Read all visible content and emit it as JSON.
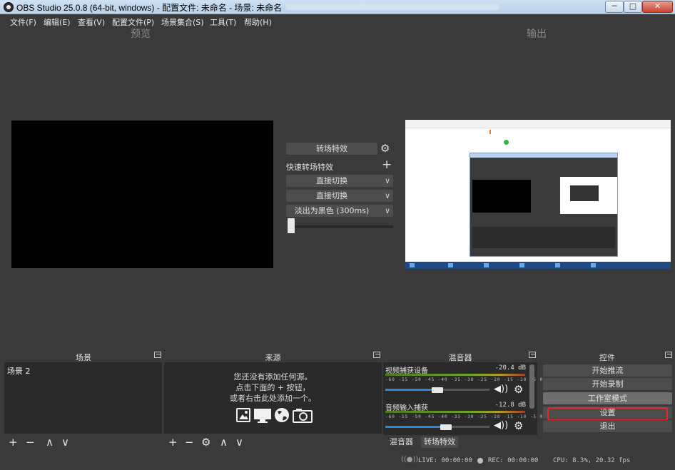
{
  "window": {
    "title": "OBS Studio 25.0.8 (64-bit, windows) - 配置文件: 未命名 - 场景: 未命名",
    "min_glyph": "─",
    "max_glyph": "□",
    "close_glyph": "✕"
  },
  "menu": {
    "items": [
      "文件(F)",
      "编辑(E)",
      "查看(V)",
      "配置文件(P)",
      "场景集合(S)",
      "工具(T)",
      "帮助(H)"
    ]
  },
  "preview": {
    "label": "预览"
  },
  "program": {
    "label": "输出"
  },
  "transitions": {
    "button_label": "转场特效",
    "gear_glyph": "⚙",
    "quick_label": "快速转场特效",
    "add_glyph": "+",
    "quick_items": [
      "直接切换",
      "直接切换",
      "淡出为黑色 (300ms)"
    ],
    "chevron_glyph": "∨",
    "t_bar_position": 0.0
  },
  "scenes": {
    "title": "场景",
    "items": [
      "场景 2"
    ],
    "toolbar": [
      "+",
      "−",
      "∧",
      "∨"
    ]
  },
  "sources": {
    "title": "来源",
    "empty_lines": [
      "您还没有添加任何源。",
      "点击下面的 + 按钮，",
      "或者右击此处添加一个。"
    ],
    "toolbar": [
      "+",
      "−",
      "⚙",
      "∧",
      "∨"
    ],
    "icons": [
      "image-icon",
      "display-icon",
      "globe-icon",
      "camera-icon"
    ]
  },
  "mixer": {
    "title": "混音器",
    "channels": [
      {
        "name": "视频捕获设备",
        "db": "-20.4 dB",
        "volume": 0.5
      },
      {
        "name": "音频输入捕获",
        "db": "-12.8 dB",
        "volume": 0.58
      }
    ],
    "scale": "-60 -55 -50 -45 -40 -35 -30 -25 -20 -15 -10 -5 0",
    "volume_glyph": "◀))",
    "gear_glyph": "⚙",
    "tabs": [
      "混音器",
      "转场特效"
    ]
  },
  "controls": {
    "title": "控件",
    "buttons": [
      "开始推流",
      "开始录制",
      "工作室模式",
      "设置",
      "退出"
    ]
  },
  "status": {
    "live_icon": "((●))",
    "live": "LIVE: 00:00:00",
    "rec": "REC: 00:00:00",
    "cpu": "CPU: 8.3%, 20.32 fps"
  },
  "colors": {
    "background": "#3a3a3a",
    "dock_body": "#2a2a2a",
    "button": "#4d4d4d",
    "highlight": "#e52828",
    "slider_fill": "#2f86d6"
  }
}
